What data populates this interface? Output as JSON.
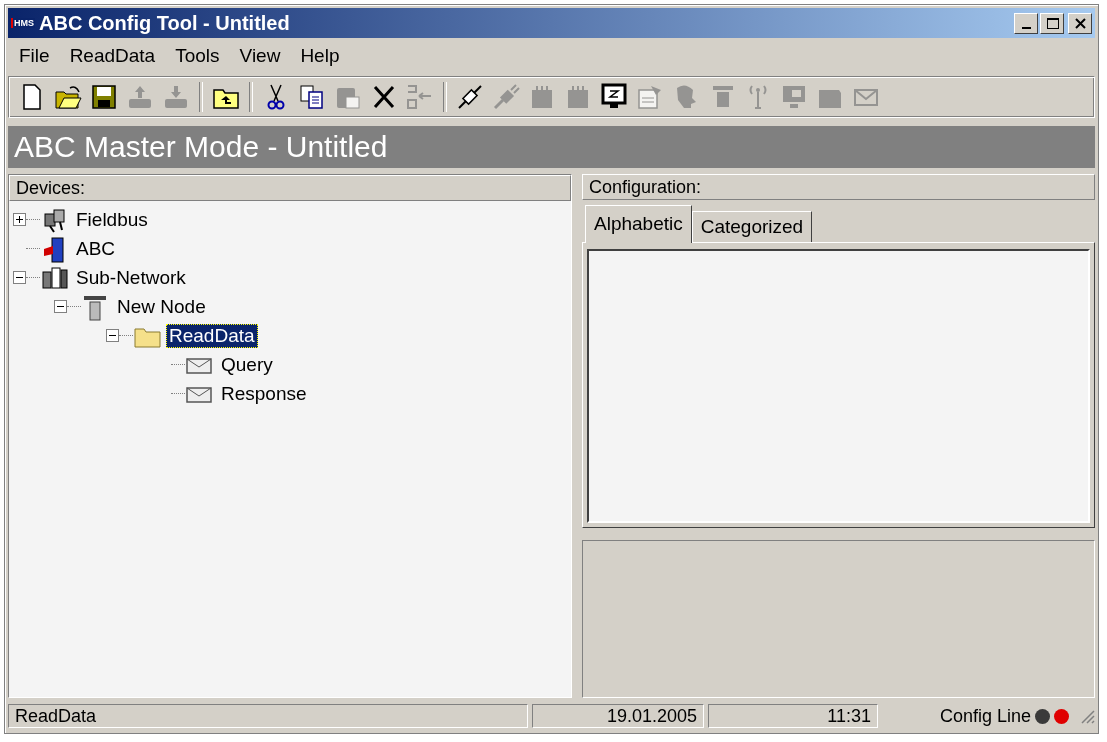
{
  "window": {
    "logo": "HMS",
    "title": "ABC Config Tool - Untitled"
  },
  "menu": [
    {
      "label": "File"
    },
    {
      "label": "ReadData"
    },
    {
      "label": "Tools"
    },
    {
      "label": "View"
    },
    {
      "label": "Help"
    }
  ],
  "toolbar": [
    [
      {
        "kind": "new",
        "disabled": false
      },
      {
        "kind": "open",
        "disabled": false
      },
      {
        "kind": "save",
        "disabled": false
      },
      {
        "kind": "upload",
        "disabled": true
      },
      {
        "kind": "download",
        "disabled": true
      }
    ],
    [
      {
        "kind": "folder-up",
        "disabled": false
      }
    ],
    [
      {
        "kind": "cut",
        "disabled": false
      },
      {
        "kind": "copy",
        "disabled": false
      },
      {
        "kind": "paste",
        "disabled": true
      },
      {
        "kind": "delete",
        "disabled": false
      },
      {
        "kind": "insert",
        "disabled": true
      }
    ],
    [
      {
        "kind": "connect",
        "disabled": false
      },
      {
        "kind": "plug",
        "disabled": true
      },
      {
        "kind": "module",
        "disabled": true
      },
      {
        "kind": "module",
        "disabled": true
      },
      {
        "kind": "monitor",
        "disabled": false
      },
      {
        "kind": "properties",
        "disabled": true
      },
      {
        "kind": "head",
        "disabled": true
      },
      {
        "kind": "node",
        "disabled": true
      },
      {
        "kind": "antenna",
        "disabled": true
      },
      {
        "kind": "screen",
        "disabled": true
      },
      {
        "kind": "card",
        "disabled": true
      },
      {
        "kind": "mail",
        "disabled": true
      }
    ]
  ],
  "mode_banner": "ABC Master Mode - Untitled",
  "devices": {
    "title": "Devices:",
    "tree": [
      {
        "label": "Fieldbus",
        "kind": "fieldbus",
        "expanded": false,
        "selected": false
      },
      {
        "label": "ABC",
        "kind": "device",
        "selected": false
      },
      {
        "label": "Sub-Network",
        "kind": "network",
        "expanded": true,
        "selected": false,
        "children": [
          {
            "label": "New Node",
            "kind": "node",
            "expanded": true,
            "selected": false,
            "children": [
              {
                "label": "ReadData",
                "kind": "folder",
                "expanded": true,
                "selected": true,
                "children": [
                  {
                    "label": "Query",
                    "kind": "message",
                    "selected": false
                  },
                  {
                    "label": "Response",
                    "kind": "message",
                    "selected": false
                  }
                ]
              }
            ]
          }
        ]
      }
    ]
  },
  "configuration": {
    "title": "Configuration:",
    "tabs": [
      {
        "label": "Alphabetic",
        "selected": true
      },
      {
        "label": "Categorized",
        "selected": false
      }
    ]
  },
  "status_bar": {
    "message": "ReadData",
    "date": "19.01.2005",
    "time": "11:31",
    "line_label": "Config Line",
    "leds": [
      {
        "color": "#3a3a3a"
      },
      {
        "color": "#e00000"
      }
    ]
  }
}
